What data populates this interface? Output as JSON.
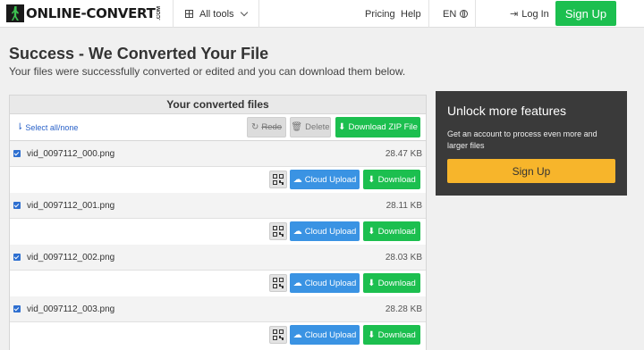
{
  "header": {
    "logo_text": "ONLINE-CONVERT",
    "logo_suffix": ".COM",
    "all_tools": "All tools",
    "pricing": "Pricing",
    "help": "Help",
    "language": "EN",
    "login": "Log In",
    "signup": "Sign Up"
  },
  "page": {
    "title": "Success - We Converted Your File",
    "subtitle": "Your files were successfully converted or edited and you can download them below."
  },
  "files_panel": {
    "title": "Your converted files",
    "select_all": "Select all/none",
    "redo": "Redo",
    "delete": "Delete",
    "download_zip": "Download ZIP File",
    "cloud_upload": "Cloud Upload",
    "download": "Download",
    "files": [
      {
        "name": "vid_0097112_000.png",
        "size": "28.47 KB",
        "checked": true
      },
      {
        "name": "vid_0097112_001.png",
        "size": "28.11 KB",
        "checked": true
      },
      {
        "name": "vid_0097112_002.png",
        "size": "28.03 KB",
        "checked": true
      },
      {
        "name": "vid_0097112_003.png",
        "size": "28.28 KB",
        "checked": true
      }
    ]
  },
  "unlock": {
    "title": "Unlock more features",
    "text": "Get an account to process even more and larger files",
    "button": "Sign Up"
  },
  "colors": {
    "green": "#1cbf4f",
    "blue": "#3a93e3",
    "orange": "#f7b52b",
    "dark_box": "#3a3a3a",
    "link": "#2a62c9"
  }
}
